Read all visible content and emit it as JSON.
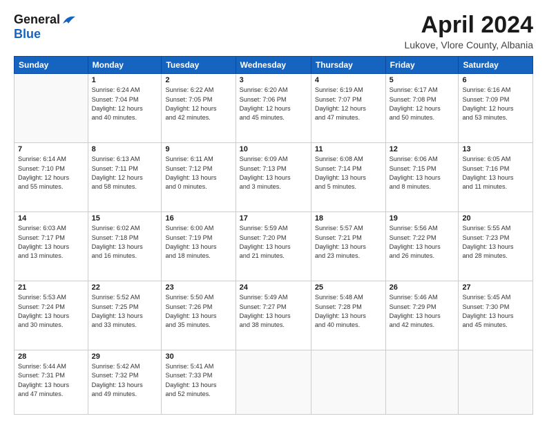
{
  "header": {
    "logo_general": "General",
    "logo_blue": "Blue",
    "month_title": "April 2024",
    "location": "Lukove, Vlore County, Albania"
  },
  "weekdays": [
    "Sunday",
    "Monday",
    "Tuesday",
    "Wednesday",
    "Thursday",
    "Friday",
    "Saturday"
  ],
  "weeks": [
    [
      {
        "day": "",
        "info": ""
      },
      {
        "day": "1",
        "info": "Sunrise: 6:24 AM\nSunset: 7:04 PM\nDaylight: 12 hours\nand 40 minutes."
      },
      {
        "day": "2",
        "info": "Sunrise: 6:22 AM\nSunset: 7:05 PM\nDaylight: 12 hours\nand 42 minutes."
      },
      {
        "day": "3",
        "info": "Sunrise: 6:20 AM\nSunset: 7:06 PM\nDaylight: 12 hours\nand 45 minutes."
      },
      {
        "day": "4",
        "info": "Sunrise: 6:19 AM\nSunset: 7:07 PM\nDaylight: 12 hours\nand 47 minutes."
      },
      {
        "day": "5",
        "info": "Sunrise: 6:17 AM\nSunset: 7:08 PM\nDaylight: 12 hours\nand 50 minutes."
      },
      {
        "day": "6",
        "info": "Sunrise: 6:16 AM\nSunset: 7:09 PM\nDaylight: 12 hours\nand 53 minutes."
      }
    ],
    [
      {
        "day": "7",
        "info": "Sunrise: 6:14 AM\nSunset: 7:10 PM\nDaylight: 12 hours\nand 55 minutes."
      },
      {
        "day": "8",
        "info": "Sunrise: 6:13 AM\nSunset: 7:11 PM\nDaylight: 12 hours\nand 58 minutes."
      },
      {
        "day": "9",
        "info": "Sunrise: 6:11 AM\nSunset: 7:12 PM\nDaylight: 13 hours\nand 0 minutes."
      },
      {
        "day": "10",
        "info": "Sunrise: 6:09 AM\nSunset: 7:13 PM\nDaylight: 13 hours\nand 3 minutes."
      },
      {
        "day": "11",
        "info": "Sunrise: 6:08 AM\nSunset: 7:14 PM\nDaylight: 13 hours\nand 5 minutes."
      },
      {
        "day": "12",
        "info": "Sunrise: 6:06 AM\nSunset: 7:15 PM\nDaylight: 13 hours\nand 8 minutes."
      },
      {
        "day": "13",
        "info": "Sunrise: 6:05 AM\nSunset: 7:16 PM\nDaylight: 13 hours\nand 11 minutes."
      }
    ],
    [
      {
        "day": "14",
        "info": "Sunrise: 6:03 AM\nSunset: 7:17 PM\nDaylight: 13 hours\nand 13 minutes."
      },
      {
        "day": "15",
        "info": "Sunrise: 6:02 AM\nSunset: 7:18 PM\nDaylight: 13 hours\nand 16 minutes."
      },
      {
        "day": "16",
        "info": "Sunrise: 6:00 AM\nSunset: 7:19 PM\nDaylight: 13 hours\nand 18 minutes."
      },
      {
        "day": "17",
        "info": "Sunrise: 5:59 AM\nSunset: 7:20 PM\nDaylight: 13 hours\nand 21 minutes."
      },
      {
        "day": "18",
        "info": "Sunrise: 5:57 AM\nSunset: 7:21 PM\nDaylight: 13 hours\nand 23 minutes."
      },
      {
        "day": "19",
        "info": "Sunrise: 5:56 AM\nSunset: 7:22 PM\nDaylight: 13 hours\nand 26 minutes."
      },
      {
        "day": "20",
        "info": "Sunrise: 5:55 AM\nSunset: 7:23 PM\nDaylight: 13 hours\nand 28 minutes."
      }
    ],
    [
      {
        "day": "21",
        "info": "Sunrise: 5:53 AM\nSunset: 7:24 PM\nDaylight: 13 hours\nand 30 minutes."
      },
      {
        "day": "22",
        "info": "Sunrise: 5:52 AM\nSunset: 7:25 PM\nDaylight: 13 hours\nand 33 minutes."
      },
      {
        "day": "23",
        "info": "Sunrise: 5:50 AM\nSunset: 7:26 PM\nDaylight: 13 hours\nand 35 minutes."
      },
      {
        "day": "24",
        "info": "Sunrise: 5:49 AM\nSunset: 7:27 PM\nDaylight: 13 hours\nand 38 minutes."
      },
      {
        "day": "25",
        "info": "Sunrise: 5:48 AM\nSunset: 7:28 PM\nDaylight: 13 hours\nand 40 minutes."
      },
      {
        "day": "26",
        "info": "Sunrise: 5:46 AM\nSunset: 7:29 PM\nDaylight: 13 hours\nand 42 minutes."
      },
      {
        "day": "27",
        "info": "Sunrise: 5:45 AM\nSunset: 7:30 PM\nDaylight: 13 hours\nand 45 minutes."
      }
    ],
    [
      {
        "day": "28",
        "info": "Sunrise: 5:44 AM\nSunset: 7:31 PM\nDaylight: 13 hours\nand 47 minutes."
      },
      {
        "day": "29",
        "info": "Sunrise: 5:42 AM\nSunset: 7:32 PM\nDaylight: 13 hours\nand 49 minutes."
      },
      {
        "day": "30",
        "info": "Sunrise: 5:41 AM\nSunset: 7:33 PM\nDaylight: 13 hours\nand 52 minutes."
      },
      {
        "day": "",
        "info": ""
      },
      {
        "day": "",
        "info": ""
      },
      {
        "day": "",
        "info": ""
      },
      {
        "day": "",
        "info": ""
      }
    ]
  ]
}
